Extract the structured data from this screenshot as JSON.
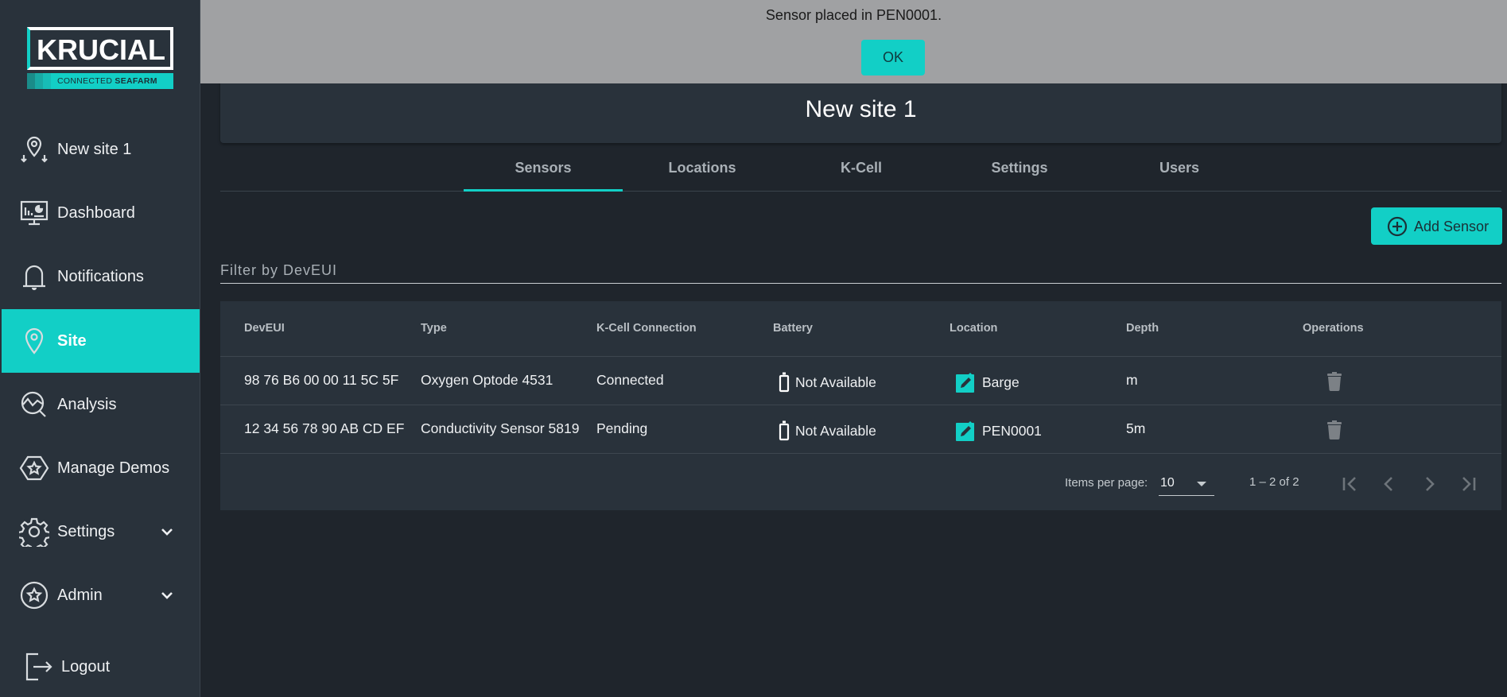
{
  "app": {
    "brand": "KRUCIAL",
    "brand_tagline_light": "CONNECTED",
    "brand_tagline_bold": "SEAFARM",
    "accent_color": "#12cfc6"
  },
  "sidebar": {
    "items": [
      {
        "label": "New site 1",
        "icon": "site-pin-icon"
      },
      {
        "label": "Dashboard",
        "icon": "dashboard-icon"
      },
      {
        "label": "Notifications",
        "icon": "bell-icon"
      },
      {
        "label": "Site",
        "icon": "location-pin-icon",
        "active": true
      },
      {
        "label": "Analysis",
        "icon": "analysis-icon"
      },
      {
        "label": "Manage Demos",
        "icon": "hexagon-star-icon"
      },
      {
        "label": "Settings",
        "icon": "gear-icon",
        "expandable": true
      },
      {
        "label": "Admin",
        "icon": "star-circle-icon",
        "expandable": true
      },
      {
        "label": "Logout",
        "icon": "logout-icon"
      }
    ]
  },
  "banner": {
    "message": "Sensor placed in PEN0001.",
    "ok_label": "OK"
  },
  "header": {
    "title": "New site 1"
  },
  "tabs": [
    {
      "label": "Sensors",
      "active": true
    },
    {
      "label": "Locations"
    },
    {
      "label": "K-Cell"
    },
    {
      "label": "Settings"
    },
    {
      "label": "Users"
    }
  ],
  "toolbar": {
    "add_sensor_label": "Add Sensor"
  },
  "filter": {
    "placeholder": "Filter by DevEUI",
    "value": ""
  },
  "table": {
    "columns": [
      "DevEUI",
      "Type",
      "K-Cell Connection",
      "Battery",
      "Location",
      "Depth",
      "Operations"
    ],
    "rows": [
      {
        "deveui": "98 76 B6 00 00 11 5C 5F",
        "type": "Oxygen Optode 4531",
        "kcell": "Connected",
        "battery": "Not Available",
        "location": "Barge",
        "depth": "m"
      },
      {
        "deveui": "12 34 56 78 90 AB CD EF",
        "type": "Conductivity Sensor 5819",
        "kcell": "Pending",
        "battery": "Not Available",
        "location": "PEN0001",
        "depth": "5m"
      }
    ]
  },
  "paginator": {
    "items_per_page_label": "Items per page:",
    "items_per_page": "10",
    "range": "1 – 2 of 2"
  }
}
